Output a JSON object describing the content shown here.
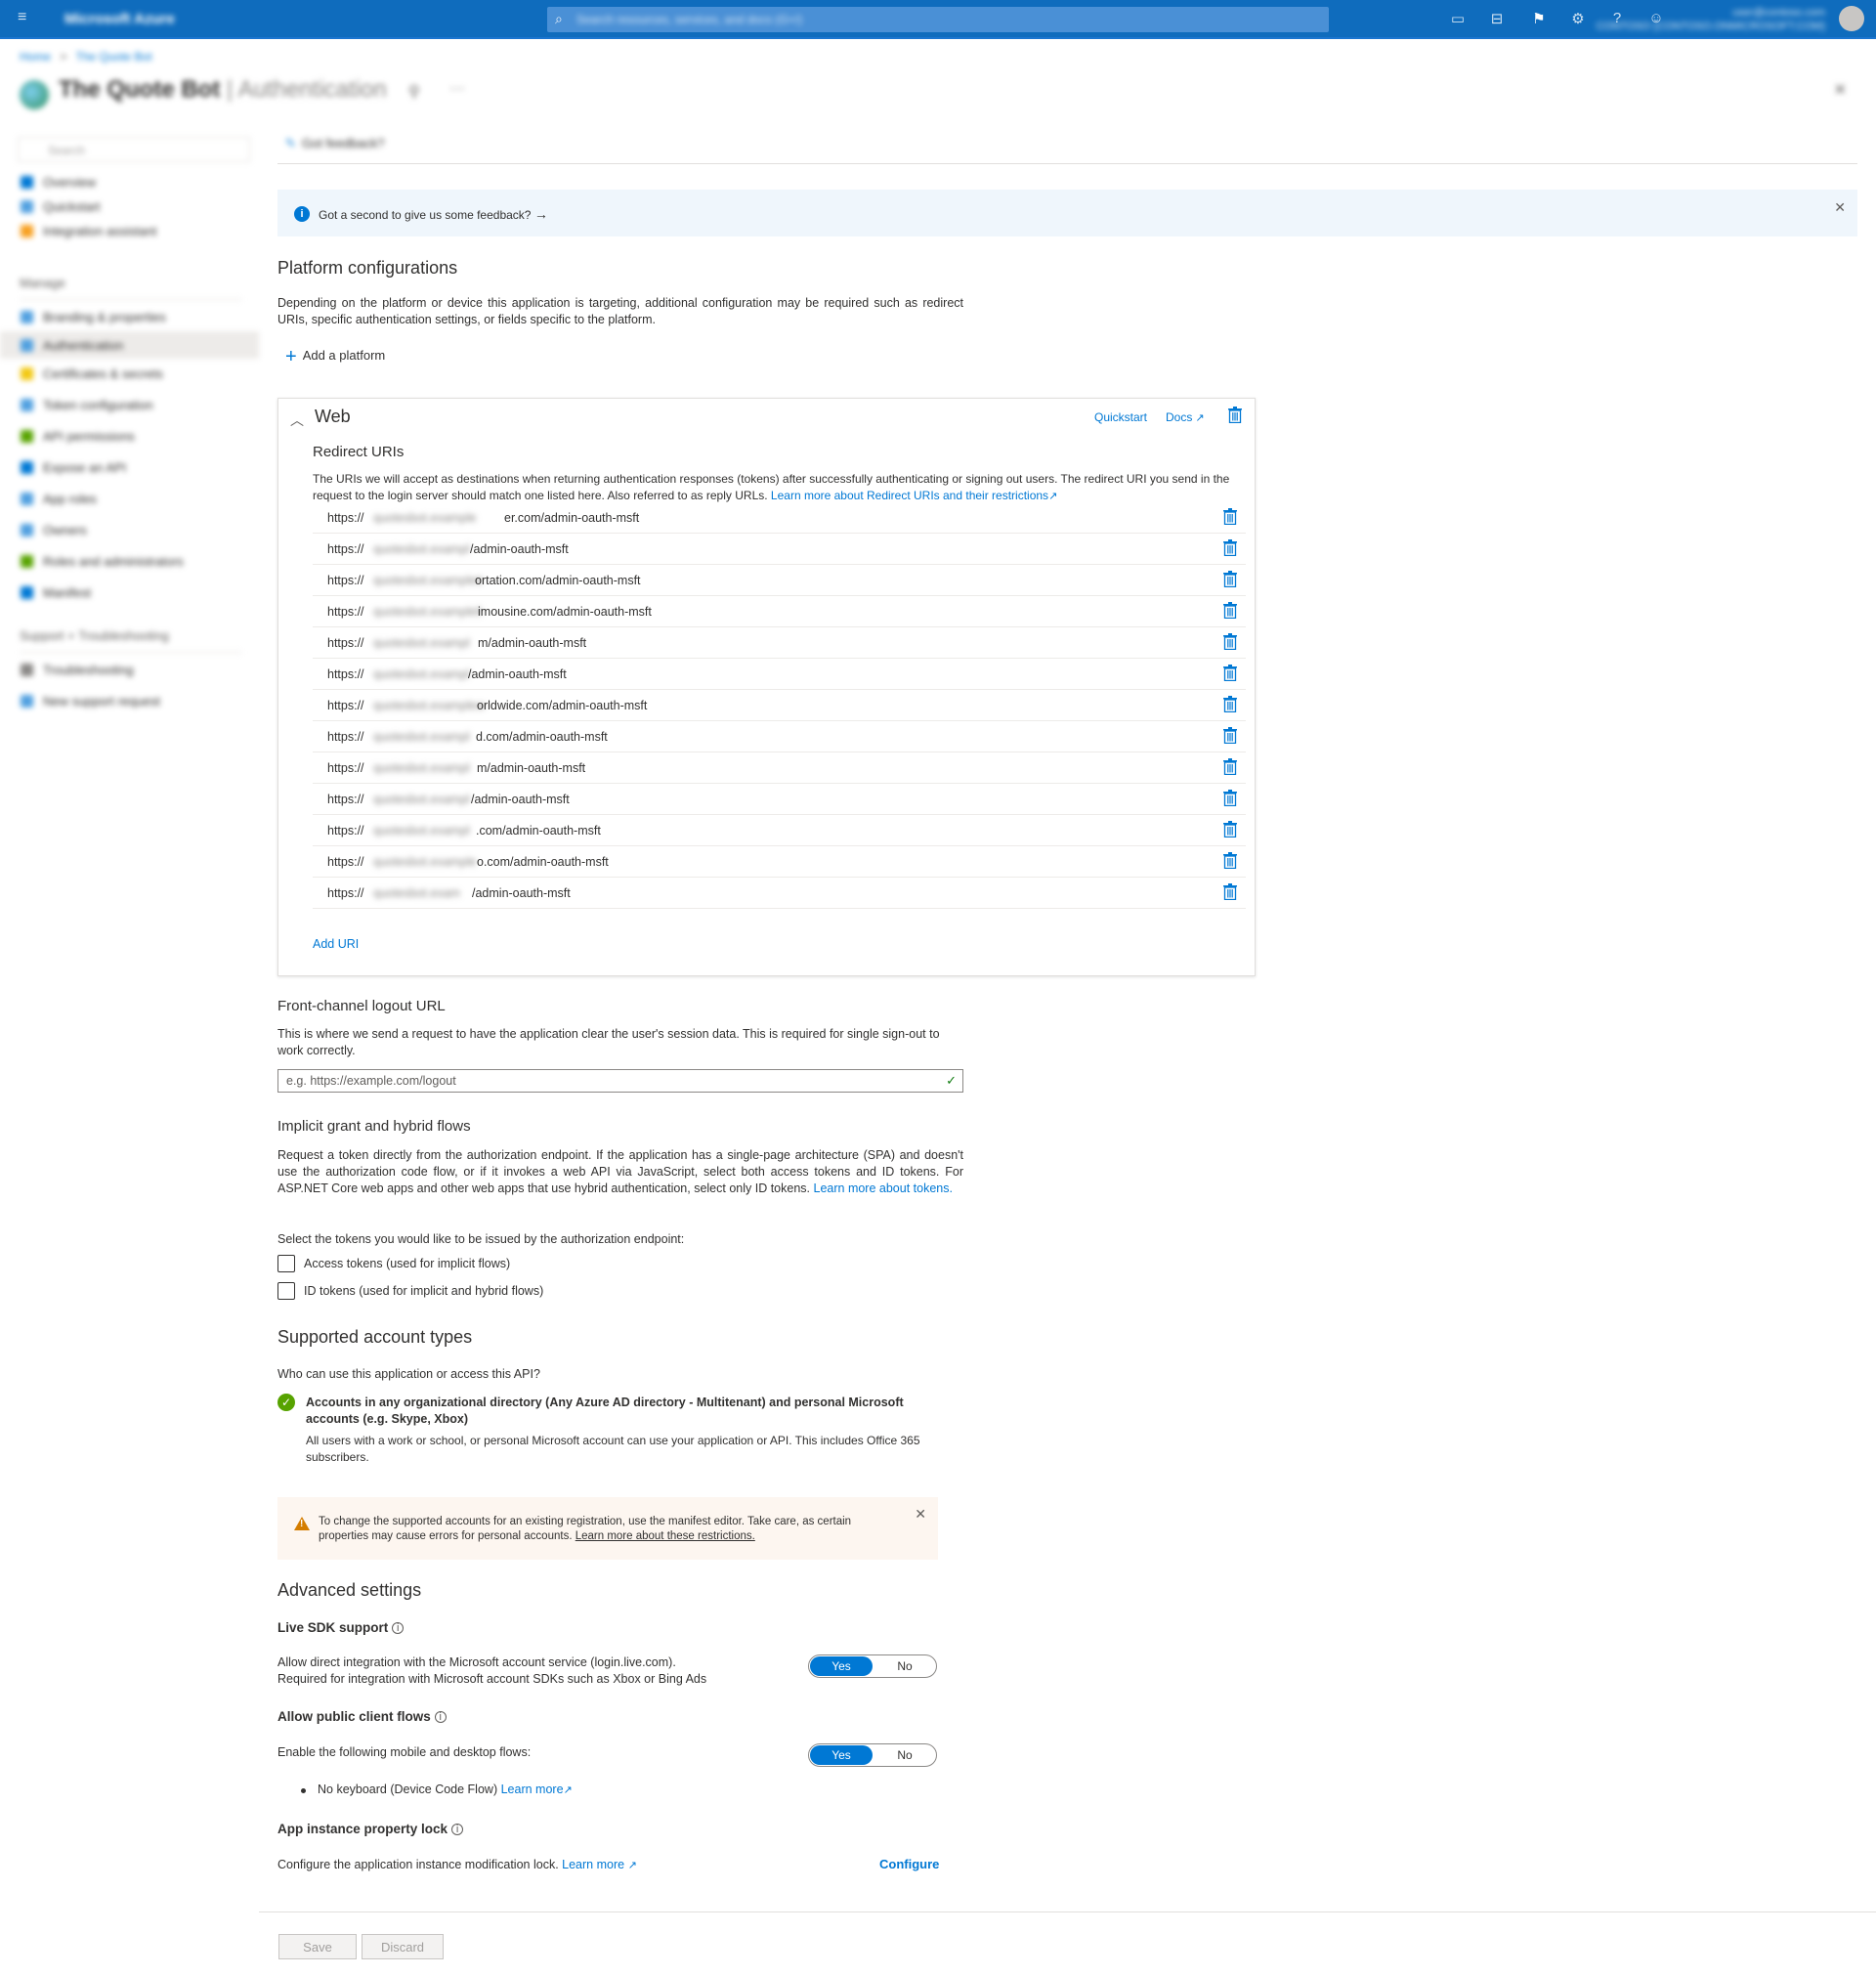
{
  "topbar": {
    "brand": "Microsoft Azure",
    "search_placeholder": "Search resources, services, and docs (G+/)",
    "account_line1": "user@contoso.com",
    "account_line2": "CONTOSO (CONTOSO.ONMICROSOFT.COM)"
  },
  "breadcrumb": {
    "home": "Home",
    "sep": ">",
    "app": "The Quote Bot"
  },
  "header": {
    "app_name": "The Quote Bot",
    "separator": " | ",
    "page": "Authentication"
  },
  "sidenav": {
    "search_placeholder": "Search",
    "top_items": [
      {
        "label": "Overview",
        "color": "#0078d4"
      },
      {
        "label": "Quickstart",
        "color": "#50a0e0"
      },
      {
        "label": "Integration assistant",
        "color": "#f7a020"
      }
    ],
    "manage_label": "Manage",
    "manage_items": [
      {
        "label": "Branding & properties",
        "color": "#50a0e0"
      },
      {
        "label": "Authentication",
        "color": "#50a0e0"
      },
      {
        "label": "Certificates & secrets",
        "color": "#f2c811"
      },
      {
        "label": "Token configuration",
        "color": "#50a0e0"
      },
      {
        "label": "API permissions",
        "color": "#57a300"
      },
      {
        "label": "Expose an API",
        "color": "#0078d4"
      },
      {
        "label": "App roles",
        "color": "#50a0e0"
      },
      {
        "label": "Owners",
        "color": "#50a0e0"
      },
      {
        "label": "Roles and administrators",
        "color": "#57a300"
      },
      {
        "label": "Manifest",
        "color": "#0078d4"
      }
    ],
    "support_label": "Support + Troubleshooting",
    "support_items": [
      {
        "label": "Troubleshooting",
        "color": "#8a8886"
      },
      {
        "label": "New support request",
        "color": "#50a0e0"
      }
    ]
  },
  "toolbar": {
    "feedback": "Got feedback?"
  },
  "info_banner": {
    "text": "Got a second to give us some feedback?",
    "arrow": "→"
  },
  "platform": {
    "title": "Platform configurations",
    "desc": "Depending on the platform or device this application is targeting, additional configuration may be required such as redirect URIs, specific authentication settings, or fields specific to the platform.",
    "add_platform": "Add a platform"
  },
  "web": {
    "title": "Web",
    "quickstart": "Quickstart",
    "docs": "Docs",
    "redirect_title": "Redirect URIs",
    "redirect_desc": "The URIs we will accept as destinations when returning authentication responses (tokens) after successfully authenticating or signing out users. The redirect URI you send in the request to the login server should match one listed here. Also referred to as reply URLs.",
    "redirect_link": "Learn more about Redirect URIs and their restrictions",
    "uris": [
      {
        "prefix": "https://",
        "hidden": "quotesbot.example",
        "suffix": "er.com/admin-oauth-msft"
      },
      {
        "prefix": "https://",
        "hidden": "quotesbot.exampl",
        "suffix": "/admin-oauth-msft"
      },
      {
        "prefix": "https://",
        "hidden": "quotesbot.exampletr",
        "suffix": "ortation.com/admin-oauth-msft"
      },
      {
        "prefix": "https://",
        "hidden": "quotesbot.exampleli",
        "suffix": "imousine.com/admin-oauth-msft"
      },
      {
        "prefix": "https://",
        "hidden": "quotesbot.exampl",
        "suffix": "m/admin-oauth-msft"
      },
      {
        "prefix": "https://",
        "hidden": "quotesbot.exampl",
        "suffix": "/admin-oauth-msft"
      },
      {
        "prefix": "https://",
        "hidden": "quotesbot.examplew",
        "suffix": "orldwide.com/admin-oauth-msft"
      },
      {
        "prefix": "https://",
        "hidden": "quotesbot.exampl",
        "suffix": "d.com/admin-oauth-msft"
      },
      {
        "prefix": "https://",
        "hidden": "quotesbot.exampl",
        "suffix": "m/admin-oauth-msft"
      },
      {
        "prefix": "https://",
        "hidden": "quotesbot.exampl",
        "suffix": "/admin-oauth-msft"
      },
      {
        "prefix": "https://",
        "hidden": "quotesbot.exampl",
        "suffix": ".com/admin-oauth-msft"
      },
      {
        "prefix": "https://",
        "hidden": "quotesbot.example",
        "suffix": "o.com/admin-oauth-msft"
      },
      {
        "prefix": "https://",
        "hidden": "quotesbot.exam",
        "suffix": "/admin-oauth-msft"
      }
    ],
    "add_uri": "Add URI"
  },
  "front_channel": {
    "title": "Front-channel logout URL",
    "desc": "This is where we send a request to have the application clear the user's session data. This is required for single sign-out to work correctly.",
    "placeholder": "e.g. https://example.com/logout",
    "value": ""
  },
  "implicit": {
    "title": "Implicit grant and hybrid flows",
    "desc": "Request a token directly from the authorization endpoint. If the application has a single-page architecture (SPA) and doesn't use the authorization code flow, or if it invokes a web API via JavaScript, select both access tokens and ID tokens. For ASP.NET Core web apps and other web apps that use hybrid authentication, select only ID tokens.",
    "link": "Learn more about tokens.",
    "select_label": "Select the tokens you would like to be issued by the authorization endpoint:",
    "access_tokens": "Access tokens (used for implicit flows)",
    "access_checked": false,
    "id_tokens": "ID tokens (used for implicit and hybrid flows)",
    "id_checked": false
  },
  "accounts": {
    "title": "Supported account types",
    "question": "Who can use this application or access this API?",
    "option_title": "Accounts in any organizational directory (Any Azure AD directory - Multitenant) and personal Microsoft accounts (e.g. Skype, Xbox)",
    "option_desc": "All users with a work or school, or personal Microsoft account can use your application or API. This includes Office 365 subscribers.",
    "warning": "To change the supported accounts for an existing registration, use the manifest editor. Take care, as certain properties may cause errors for personal accounts.",
    "warning_link": "Learn more about these restrictions."
  },
  "advanced": {
    "title": "Advanced settings",
    "live_sdk": {
      "title": "Live SDK support",
      "desc1": "Allow direct integration with the Microsoft account service (login.live.com).",
      "desc2": "Required for integration with Microsoft account SDKs such as Xbox or Bing Ads",
      "yes": "Yes",
      "no": "No",
      "selected": "Yes"
    },
    "public_client": {
      "title": "Allow public client flows",
      "desc": "Enable the following mobile and desktop flows:",
      "yes": "Yes",
      "no": "No",
      "selected": "Yes",
      "bullet": "No keyboard (Device Code Flow)",
      "bullet_link": "Learn more"
    },
    "instance_lock": {
      "title": "App instance property lock",
      "desc": "Configure the application instance modification lock.",
      "link": "Learn more",
      "configure": "Configure"
    }
  },
  "footer": {
    "save": "Save",
    "discard": "Discard"
  }
}
